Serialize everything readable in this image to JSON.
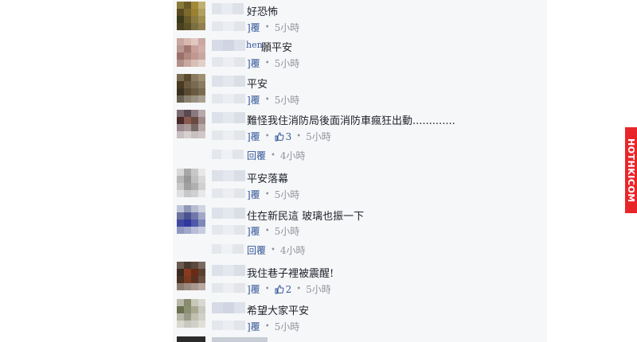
{
  "watermark": "HOTHKICOM",
  "reply_label": "回覆",
  "comments": [
    {
      "text": "好恐怖",
      "time": "5小時",
      "reply_prefix": "]覆"
    },
    {
      "text": "願平安",
      "name_partial": "hen",
      "time": "5小時",
      "reply_prefix": "]覆"
    },
    {
      "text": "平安",
      "time": "5小時",
      "reply_prefix": "]覆"
    },
    {
      "text": "難怪我住消防局後面消防車瘋狂出動.............",
      "time": "5小時",
      "likes": "3",
      "reply_prefix": "]覆",
      "sub_reply": {
        "label": "回覆",
        "time": "4小時"
      }
    },
    {
      "text": "平安落幕",
      "time": "5小時",
      "reply_prefix": "]覆"
    },
    {
      "text": "住在新民這 玻璃也振一下",
      "time": "5小時",
      "reply_prefix": "]覆",
      "sub_reply": {
        "label": "回覆",
        "time": "4小時"
      }
    },
    {
      "text": "我住巷子裡被震醒!",
      "time": "5小時",
      "likes": "2",
      "reply_prefix": "]覆"
    },
    {
      "text": "希望大家平安",
      "time": "5小時",
      "reply_prefix": "]覆"
    }
  ],
  "colors": {
    "link": "#365899",
    "time": "#90949c",
    "watermark_bg": "#e8262a"
  }
}
